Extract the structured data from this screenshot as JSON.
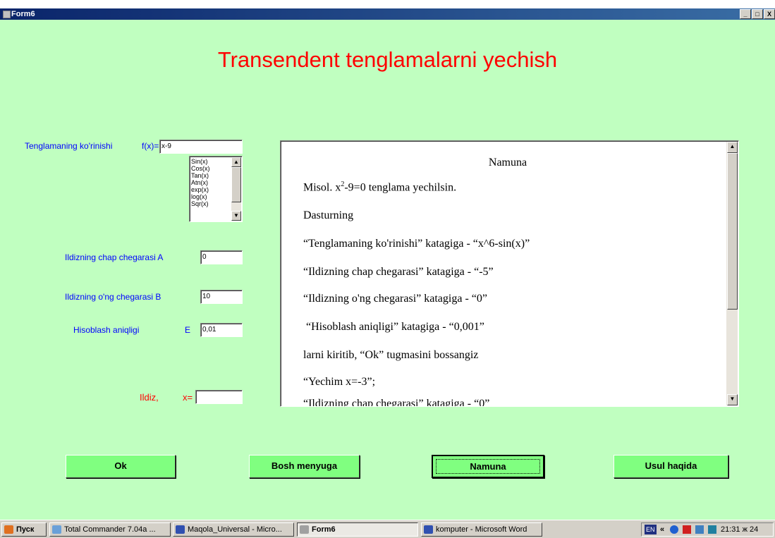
{
  "window": {
    "title": "Form6",
    "controls": [
      "_",
      "□",
      "X"
    ]
  },
  "heading": "Transendent tenglamalarni yechish",
  "form": {
    "equation_label": "Tenglamaning ko'rinishi",
    "fx_label": "f(x)=",
    "equation_value": "x-9",
    "functions": [
      "Sin(x)",
      "Cos(x)",
      "Tan(x)",
      "Atn(x)",
      "exp(x)",
      "log(x)",
      "Sqr(x)"
    ],
    "left_bound_label": "Ildizning chap chegarasi  A",
    "left_bound_value": "0",
    "right_bound_label": "Ildizning o'ng chegarasi  B",
    "right_bound_value": "10",
    "precision_label": "Hisoblash aniqligi",
    "precision_letter": "E",
    "precision_value": "0,01",
    "root_label": "Ildiz,",
    "root_x_label": "x=",
    "root_value": ""
  },
  "sample": {
    "title": "Namuna",
    "line1_prefix": "Misol. x",
    "line1_sup": "2",
    "line1_suffix": "-9=0 tenglama yechilsin.",
    "lines": [
      "Dasturning",
      "“Tenglamaning ko'rinishi” katagiga - “x^6-sin(x)”",
      "“Ildizning chap chegarasi” katagiga - “-5”",
      "“Ildizning o'ng chegarasi” katagiga - “0”",
      " “Hisoblash aniqligi” katagiga - “0,001”",
      "larni kiritib, “Ok” tugmasini bossangiz",
      "“Yechim x=-3”;",
      "“Ildizning chap chegarasi” katagiga - “0”"
    ]
  },
  "buttons": {
    "ok": "Ok",
    "main_menu": "Bosh menyuga",
    "sample": "Namuna",
    "about": "Usul haqida"
  },
  "taskbar": {
    "start": "Пуск",
    "items": [
      "Total Commander 7.04a ...",
      "Maqola_Universal - Micro...",
      "Form6",
      "komputer - Microsoft Word"
    ],
    "lang": "EN",
    "time": "21:31 ж 24"
  },
  "colors": {
    "background": "#c0ffc0",
    "heading": "#ff0000",
    "label": "#0000ff",
    "button": "#80ff80"
  }
}
